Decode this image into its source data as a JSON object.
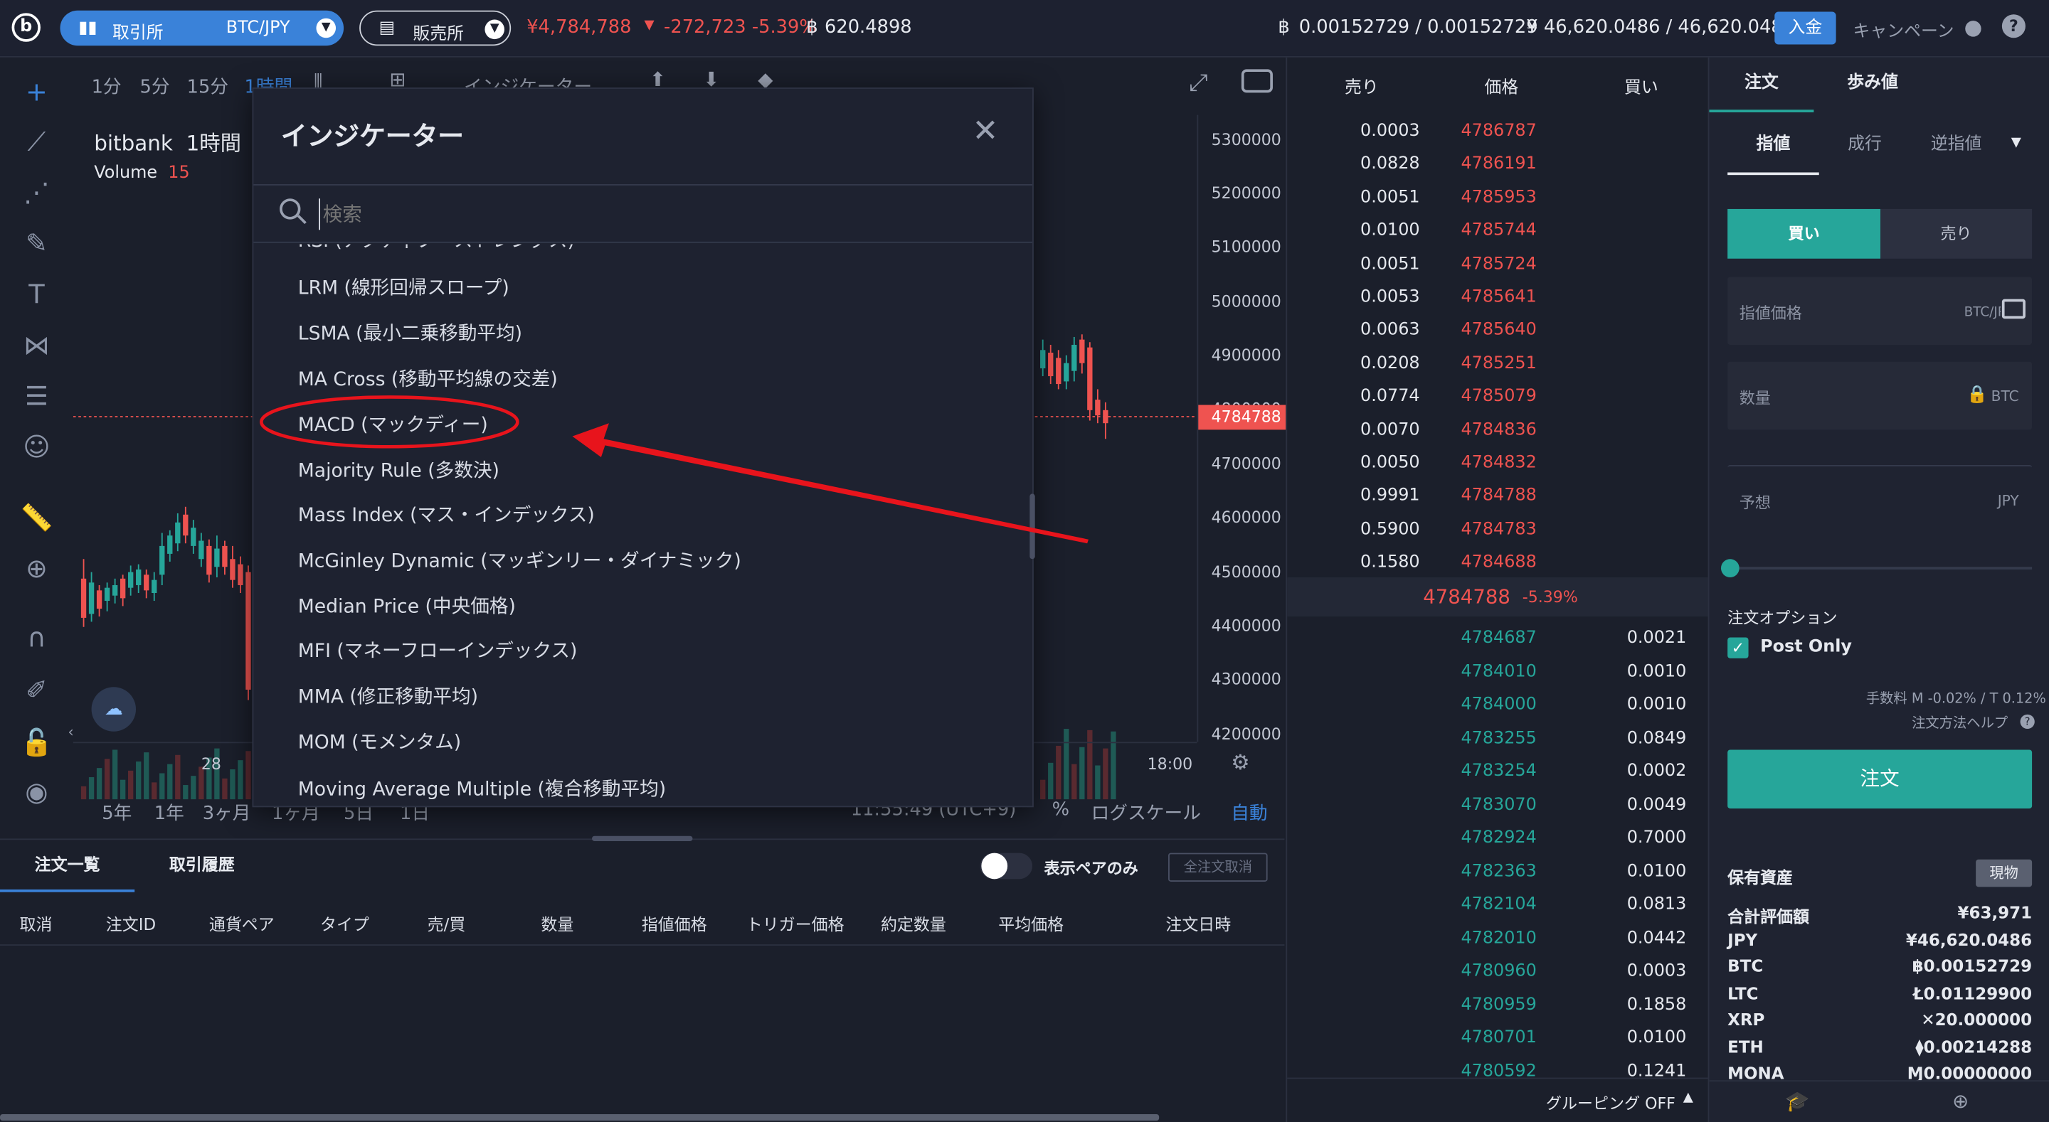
{
  "header": {
    "logo": "b",
    "market_label": "取引所",
    "pair": "BTC/JPY",
    "store_label": "販売所",
    "price": "¥4,784,788",
    "change": "-272,723 -5.39%",
    "volume": "620.4898",
    "btc_balance": "0.00152729 / 0.00152729",
    "jpy_balance": "¥ 46,620.0486 / 46,620.0486",
    "deposit": "入金",
    "campaign": "キャンペーン"
  },
  "chart_toolbar": {
    "intervals": [
      "1分",
      "5分",
      "15分",
      "1時間"
    ],
    "indicator_btn": "インジケーター"
  },
  "chart": {
    "title": "bitbank",
    "interval": "1時間",
    "volume_label": "Volume",
    "volume_value": "15",
    "price_ticks": [
      "5300000",
      "5200000",
      "5100000",
      "5000000",
      "4900000",
      "4800000",
      "4700000",
      "4600000",
      "4500000",
      "4400000",
      "4300000",
      "4200000"
    ],
    "current_price": "4784788",
    "x_labels": [
      "28",
      "18:00"
    ],
    "ranges": [
      "5年",
      "1年",
      "3ヶ月",
      "1ヶ月",
      "5日",
      "1日"
    ],
    "time": "11:55:49 (UTC+9)",
    "pct": "%",
    "log": "ログスケール",
    "auto": "自動"
  },
  "modal": {
    "title": "インジケーター",
    "search_placeholder": "検索",
    "items": [
      "RSI (アクティブ・ストレングス)",
      "LRM (線形回帰スロープ)",
      "LSMA (最小二乗移動平均)",
      "MA Cross (移動平均線の交差)",
      "MACD (マックディー)",
      "Majority Rule (多数決)",
      "Mass Index (マス・インデックス)",
      "McGinley Dynamic (マッギンリー・ダイナミック)",
      "Median Price (中央価格)",
      "MFI (マネーフローインデックス)",
      "MMA (修正移動平均)",
      "MOM (モメンタム)",
      "Moving Average Multiple (複合移動平均)"
    ]
  },
  "orderbook": {
    "h_sell": "売り",
    "h_price": "価格",
    "h_buy": "買い",
    "asks": [
      {
        "q": "0.0003",
        "p": "4786787"
      },
      {
        "q": "0.0828",
        "p": "4786191"
      },
      {
        "q": "0.0051",
        "p": "4785953"
      },
      {
        "q": "0.0100",
        "p": "4785744"
      },
      {
        "q": "0.0051",
        "p": "4785724"
      },
      {
        "q": "0.0053",
        "p": "4785641"
      },
      {
        "q": "0.0063",
        "p": "4785640"
      },
      {
        "q": "0.0208",
        "p": "4785251"
      },
      {
        "q": "0.0774",
        "p": "4785079"
      },
      {
        "q": "0.0070",
        "p": "4784836"
      },
      {
        "q": "0.0050",
        "p": "4784832"
      },
      {
        "q": "0.9991",
        "p": "4784788"
      },
      {
        "q": "0.5900",
        "p": "4784783"
      },
      {
        "q": "0.1580",
        "p": "4784688"
      }
    ],
    "last": "4784788",
    "last_change": "-5.39%",
    "bids": [
      {
        "p": "4784687",
        "q": "0.0021"
      },
      {
        "p": "4784010",
        "q": "0.0010"
      },
      {
        "p": "4784000",
        "q": "0.0010"
      },
      {
        "p": "4783255",
        "q": "0.0849"
      },
      {
        "p": "4783254",
        "q": "0.0002"
      },
      {
        "p": "4783070",
        "q": "0.0049"
      },
      {
        "p": "4782924",
        "q": "0.7000"
      },
      {
        "p": "4782363",
        "q": "0.0100"
      },
      {
        "p": "4782104",
        "q": "0.0813"
      },
      {
        "p": "4782010",
        "q": "0.0442"
      },
      {
        "p": "4780960",
        "q": "0.0003"
      },
      {
        "p": "4780959",
        "q": "0.1858"
      },
      {
        "p": "4780701",
        "q": "0.0100"
      },
      {
        "p": "4780592",
        "q": "0.1241"
      }
    ],
    "grouping": "グルーピング OFF"
  },
  "order": {
    "tab_order": "注文",
    "tab_trades": "歩み値",
    "types": [
      "指値",
      "成行",
      "逆指値"
    ],
    "buy": "買い",
    "sell": "売り",
    "limit_price": "指値価格",
    "limit_unit": "BTC/JPY",
    "amount": "数量",
    "amount_unit": "BTC",
    "estimate": "予想",
    "estimate_unit": "JPY",
    "options": "注文オプション",
    "post_only": "Post Only",
    "fee": "手数料 M -0.02% / T 0.12%",
    "help": "注文方法ヘルプ",
    "submit": "注文",
    "assets_title": "保有資産",
    "spot": "現物",
    "assets": [
      {
        "name": "合計評価額",
        "value": "¥63,971"
      },
      {
        "name": "JPY",
        "value": "¥46,620.0486"
      },
      {
        "name": "BTC",
        "value": "฿0.00152729"
      },
      {
        "name": "LTC",
        "value": "Ł0.01129900"
      },
      {
        "name": "XRP",
        "value": "✕20.000000"
      },
      {
        "name": "ETH",
        "value": "⧫0.00214288"
      },
      {
        "name": "MONA",
        "value": "Ɱ0.00000000"
      }
    ]
  },
  "bottom": {
    "tab_orders": "注文一覧",
    "tab_history": "取引履歴",
    "pair_only": "表示ペアのみ",
    "cancel_all": "全注文取消",
    "columns": [
      "取消",
      "注文ID",
      "通貨ペア",
      "タイプ",
      "売/買",
      "数量",
      "指値価格",
      "トリガー価格",
      "約定数量",
      "平均価格",
      "注文日時"
    ]
  },
  "colors": {
    "accent": "#3a82d9",
    "up": "#26a69a",
    "down": "#ef5350",
    "annotation": "#e8141c"
  }
}
